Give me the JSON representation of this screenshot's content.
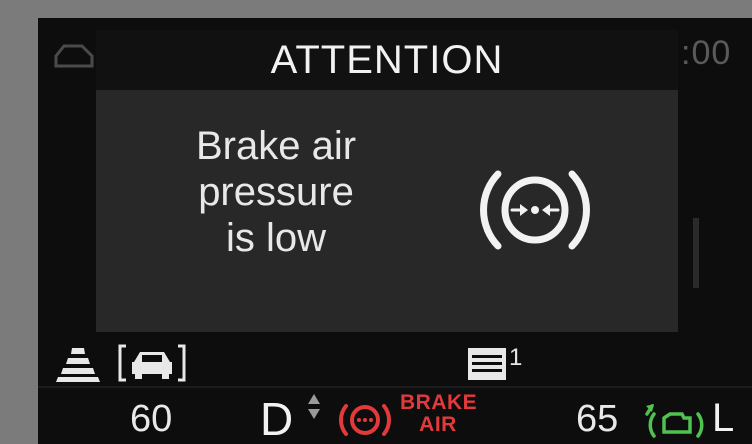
{
  "background": {
    "clock_fragment": ":00"
  },
  "alert": {
    "title": "ATTENTION",
    "message_lines": [
      "Brake air",
      "pressure",
      "is low"
    ],
    "icon": "brake-air-pressure-icon"
  },
  "status_row": {
    "lane_icon": "lane-assist-icon",
    "acc_icon": "adaptive-cruise-car-icon",
    "menu_icon": "menu-list-icon",
    "menu_count": "1"
  },
  "bottom_bar": {
    "speed": "60",
    "gear": "D",
    "brake_air_label_1": "BRAKE",
    "brake_air_label_2": "AIR",
    "fuel_value": "65",
    "fuel_unit": "L",
    "warning_color": "#e23a3a",
    "engine_icon_color": "#4fc24f"
  }
}
